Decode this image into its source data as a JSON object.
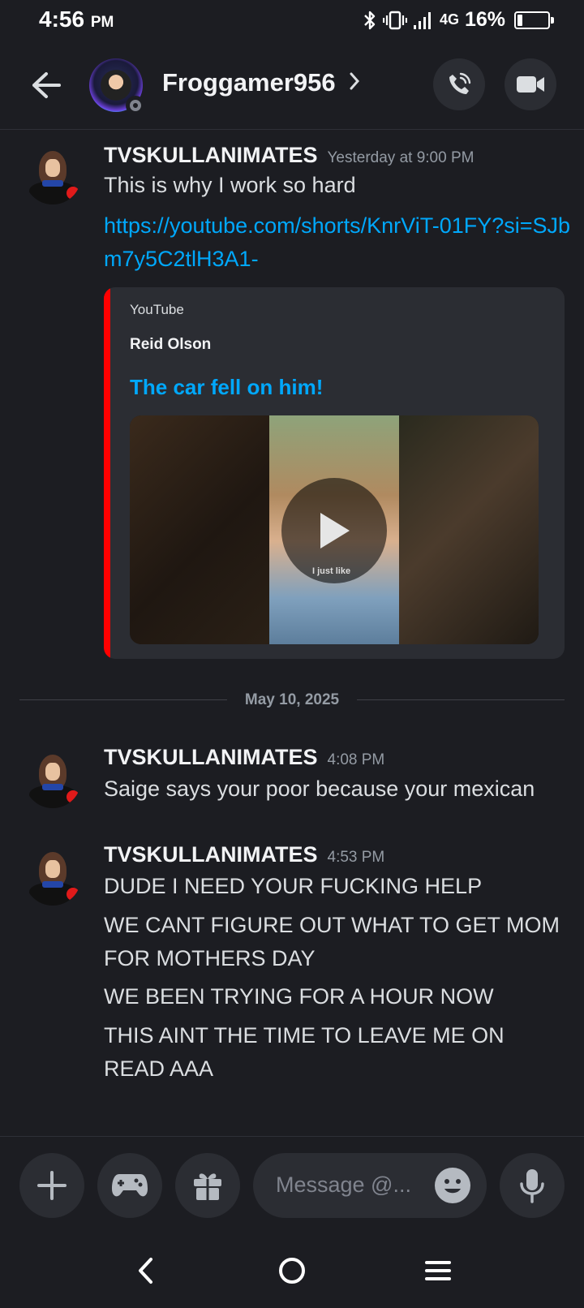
{
  "status_bar": {
    "time": "4:56",
    "ampm": "PM",
    "network": "4G",
    "battery_percent": "16%",
    "battery_level": 0.16
  },
  "header": {
    "title": "Froggamer956",
    "icons": [
      "back-arrow-icon",
      "chevron-right-icon",
      "phone-call-icon",
      "video-camera-icon"
    ]
  },
  "messages": [
    {
      "username": "TVSKULLANIMATES",
      "timestamp": "Yesterday at 9:00 PM",
      "lines": [
        "This is why I work so hard"
      ],
      "link": "https://youtube.com/shorts/KnrViT-01FY?si=SJbm7y5C2tlH3A1-",
      "embed": {
        "provider": "YouTube",
        "author": "Reid Olson",
        "title": "The car fell on him!",
        "video_caption": "I just like",
        "accent_color": "#ff0000"
      }
    },
    {
      "username": "TVSKULLANIMATES",
      "timestamp": "4:08 PM",
      "lines": [
        "Saige says your poor because your mexican"
      ]
    },
    {
      "username": "TVSKULLANIMATES",
      "timestamp": "4:53 PM",
      "lines": [
        "DUDE I NEED YOUR FUCKING HELP",
        "WE CANT FIGURE OUT WHAT TO GET MOM FOR MOTHERS DAY",
        "WE BEEN TRYING FOR A HOUR NOW",
        "THIS AINT THE TIME TO LEAVE ME ON READ AAA"
      ]
    }
  ],
  "date_divider": "May 10, 2025",
  "composer": {
    "placeholder": "Message @...",
    "icons": [
      "plus-icon",
      "gamepad-icon",
      "gift-icon",
      "emoji-icon",
      "microphone-icon"
    ]
  },
  "colors": {
    "background": "#1c1d22",
    "link": "#00a8fc",
    "surface": "#2b2d33"
  }
}
